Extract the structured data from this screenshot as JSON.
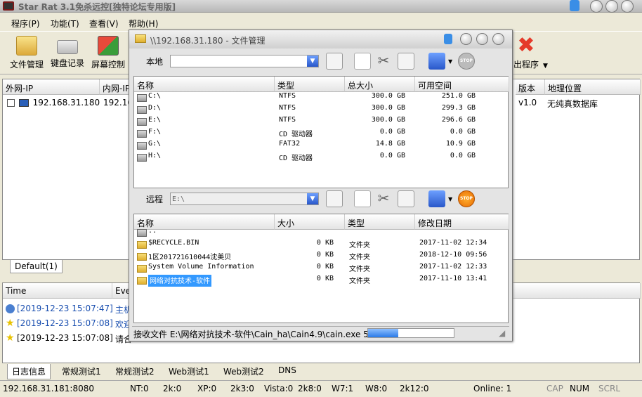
{
  "window": {
    "title": "Star Rat 3.1免杀远控[独特论坛专用版]"
  },
  "menu": [
    "程序(P)",
    "功能(T)",
    "查看(V)",
    "帮助(H)"
  ],
  "toolbar": {
    "file_manager": "文件管理",
    "keylogger": "键盘记录",
    "screen": "屏幕控制",
    "exit": "出程序"
  },
  "hosts": {
    "columns": {
      "wan_ip": "外网-IP",
      "lan_ip": "内网-IP",
      "version": "版本",
      "location": "地理位置"
    },
    "rows": [
      {
        "wan_ip": "192.168.31.180",
        "lan_ip": "192.16",
        "version": "v1.0",
        "location": "无纯真数据库"
      }
    ],
    "tab": "Default(1)"
  },
  "log": {
    "columns": {
      "time": "Time",
      "event": "Eve"
    },
    "rows": [
      {
        "time": "[2019-12-23 15:07:47]",
        "event": "主机"
      },
      {
        "time": "[2019-12-23 15:07:08]",
        "event": "欢迎"
      },
      {
        "time": "[2019-12-23 15:07:08]",
        "event": "请合"
      }
    ],
    "tabs": [
      "日志信息",
      "常规测试1",
      "常规测试2",
      "Web测试1",
      "Web测试2",
      "DNS"
    ]
  },
  "status": {
    "address": "192.168.31.181:8080",
    "nt": "NT:0",
    "k2k": "2k:0",
    "xp": "XP:0",
    "k2k3": "2k3:0",
    "vista": "Vista:0",
    "k2k8": "2k8:0",
    "w7": "W7:1",
    "w8": "W8:0",
    "k2k12": "2k12:0",
    "online": "Online: 1",
    "caps": "CAP",
    "num": "NUM",
    "scrl": "SCRL"
  },
  "file_manager": {
    "title": "\\\\192.168.31.180 - 文件管理",
    "local_label": "本地",
    "local_path": "",
    "local_columns": {
      "name": "名称",
      "type": "类型",
      "total": "总大小",
      "free": "可用空间"
    },
    "local_drives": [
      {
        "name": "C:\\",
        "type": "NTFS",
        "total": "300.0 GB",
        "free": "251.0 GB"
      },
      {
        "name": "D:\\",
        "type": "NTFS",
        "total": "300.0 GB",
        "free": "299.3 GB"
      },
      {
        "name": "E:\\",
        "type": "NTFS",
        "total": "300.0 GB",
        "free": "296.6 GB"
      },
      {
        "name": "F:\\",
        "type": "CD 驱动器",
        "total": "0.0 GB",
        "free": "0.0 GB"
      },
      {
        "name": "G:\\",
        "type": "FAT32",
        "total": "14.8 GB",
        "free": "10.9 GB"
      },
      {
        "name": "H:\\",
        "type": "CD 驱动器",
        "total": "0.0 GB",
        "free": "0.0 GB"
      }
    ],
    "remote_label": "远程",
    "remote_path": "E:\\",
    "remote_columns": {
      "name": "名称",
      "size": "大小",
      "type": "类型",
      "modified": "修改日期"
    },
    "remote_files": [
      {
        "name": "..",
        "size": "",
        "type": "",
        "modified": ""
      },
      {
        "name": "$RECYCLE.BIN",
        "size": "0 KB",
        "type": "文件夹",
        "modified": "2017-11-02 12:34"
      },
      {
        "name": "1区201721610044沈美贝",
        "size": "0 KB",
        "type": "文件夹",
        "modified": "2018-12-10 09:56"
      },
      {
        "name": "System Volume Information",
        "size": "0 KB",
        "type": "文件夹",
        "modified": "2017-11-02 12:33"
      },
      {
        "name": "网络对抗技术-软件",
        "size": "0 KB",
        "type": "文件夹",
        "modified": "2017-11-10 13:41"
      }
    ],
    "status_text": "接收文件 E:\\网络对抗技术-软件\\Cain_ha\\Cain4.9\\cain.exe 5:",
    "progress": 0.35,
    "stop_label": "STOP"
  }
}
